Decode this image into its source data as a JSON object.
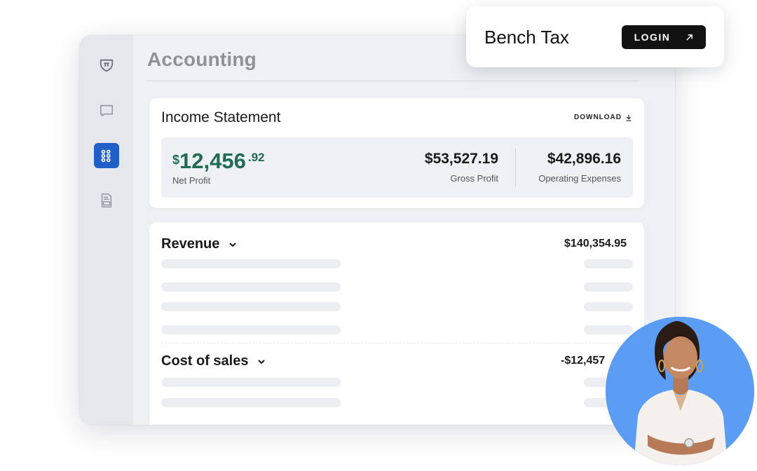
{
  "app": {
    "title": "Accounting"
  },
  "sidebar": {
    "items": [
      {
        "icon": "shield-logo-icon",
        "active": false
      },
      {
        "icon": "chat-icon",
        "active": false
      },
      {
        "icon": "grid-apps-icon",
        "active": true
      },
      {
        "icon": "tax-document-icon",
        "active": false
      }
    ]
  },
  "income_statement": {
    "title": "Income Statement",
    "download_label": "DOWNLOAD",
    "net_profit": {
      "currency": "$",
      "whole": "12,456",
      "cents": ".92",
      "label": "Net Profit"
    },
    "gross_profit": {
      "value": "$53,527.19",
      "label": "Gross Profit"
    },
    "operating_expenses": {
      "value": "$42,896.16",
      "label": "Operating Expenses"
    }
  },
  "sections": {
    "revenue": {
      "title": "Revenue",
      "amount": "$140,354.95"
    },
    "cost_of_sales": {
      "title": "Cost of sales",
      "amount": "-$12,457"
    }
  },
  "popup": {
    "title": "Bench Tax",
    "login_label": "LOGIN"
  },
  "colors": {
    "accent_blue": "#1f5fc6",
    "profit_green": "#1f6b54",
    "login_button": "#121212",
    "avatar_bg": "#5b9cf4"
  }
}
